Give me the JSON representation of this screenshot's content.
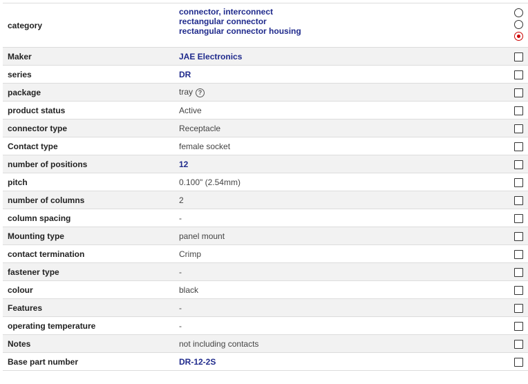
{
  "category": {
    "label": "category",
    "values": [
      "connector, interconnect",
      "rectangular connector",
      "rectangular connector housing"
    ],
    "selected_index": 2
  },
  "rows": [
    {
      "label": "Maker",
      "value": "JAE Electronics",
      "link": true
    },
    {
      "label": "series",
      "value": "DR",
      "link": true
    },
    {
      "label": "package",
      "value": "tray",
      "link": false,
      "help_icon": "question-circle-icon"
    },
    {
      "label": "product status",
      "value": "Active",
      "link": false
    },
    {
      "label": "connector type",
      "value": "Receptacle",
      "link": false
    },
    {
      "label": "Contact type",
      "value": "female socket",
      "link": false
    },
    {
      "label": "number of positions",
      "value": "12",
      "link": true
    },
    {
      "label": "pitch",
      "value": "0.100\" (2.54mm)",
      "link": false
    },
    {
      "label": "number of columns",
      "value": "2",
      "link": false
    },
    {
      "label": "column spacing",
      "value": "-",
      "link": false
    },
    {
      "label": "Mounting type",
      "value": "panel mount",
      "link": false
    },
    {
      "label": "contact termination",
      "value": "Crimp",
      "link": false
    },
    {
      "label": "fastener type",
      "value": "-",
      "link": false
    },
    {
      "label": "colour",
      "value": "black",
      "link": false
    },
    {
      "label": "Features",
      "value": "-",
      "link": false
    },
    {
      "label": "operating temperature",
      "value": "-",
      "link": false
    },
    {
      "label": "Notes",
      "value": "not including contacts",
      "link": false
    },
    {
      "label": "Base part number",
      "value": "DR-12-2S",
      "link": true
    }
  ],
  "colors": {
    "link": "#1f2a8c",
    "radio_checked": "#cc0000",
    "row_shade": "#f2f2f2",
    "border": "#dcdcdc"
  }
}
